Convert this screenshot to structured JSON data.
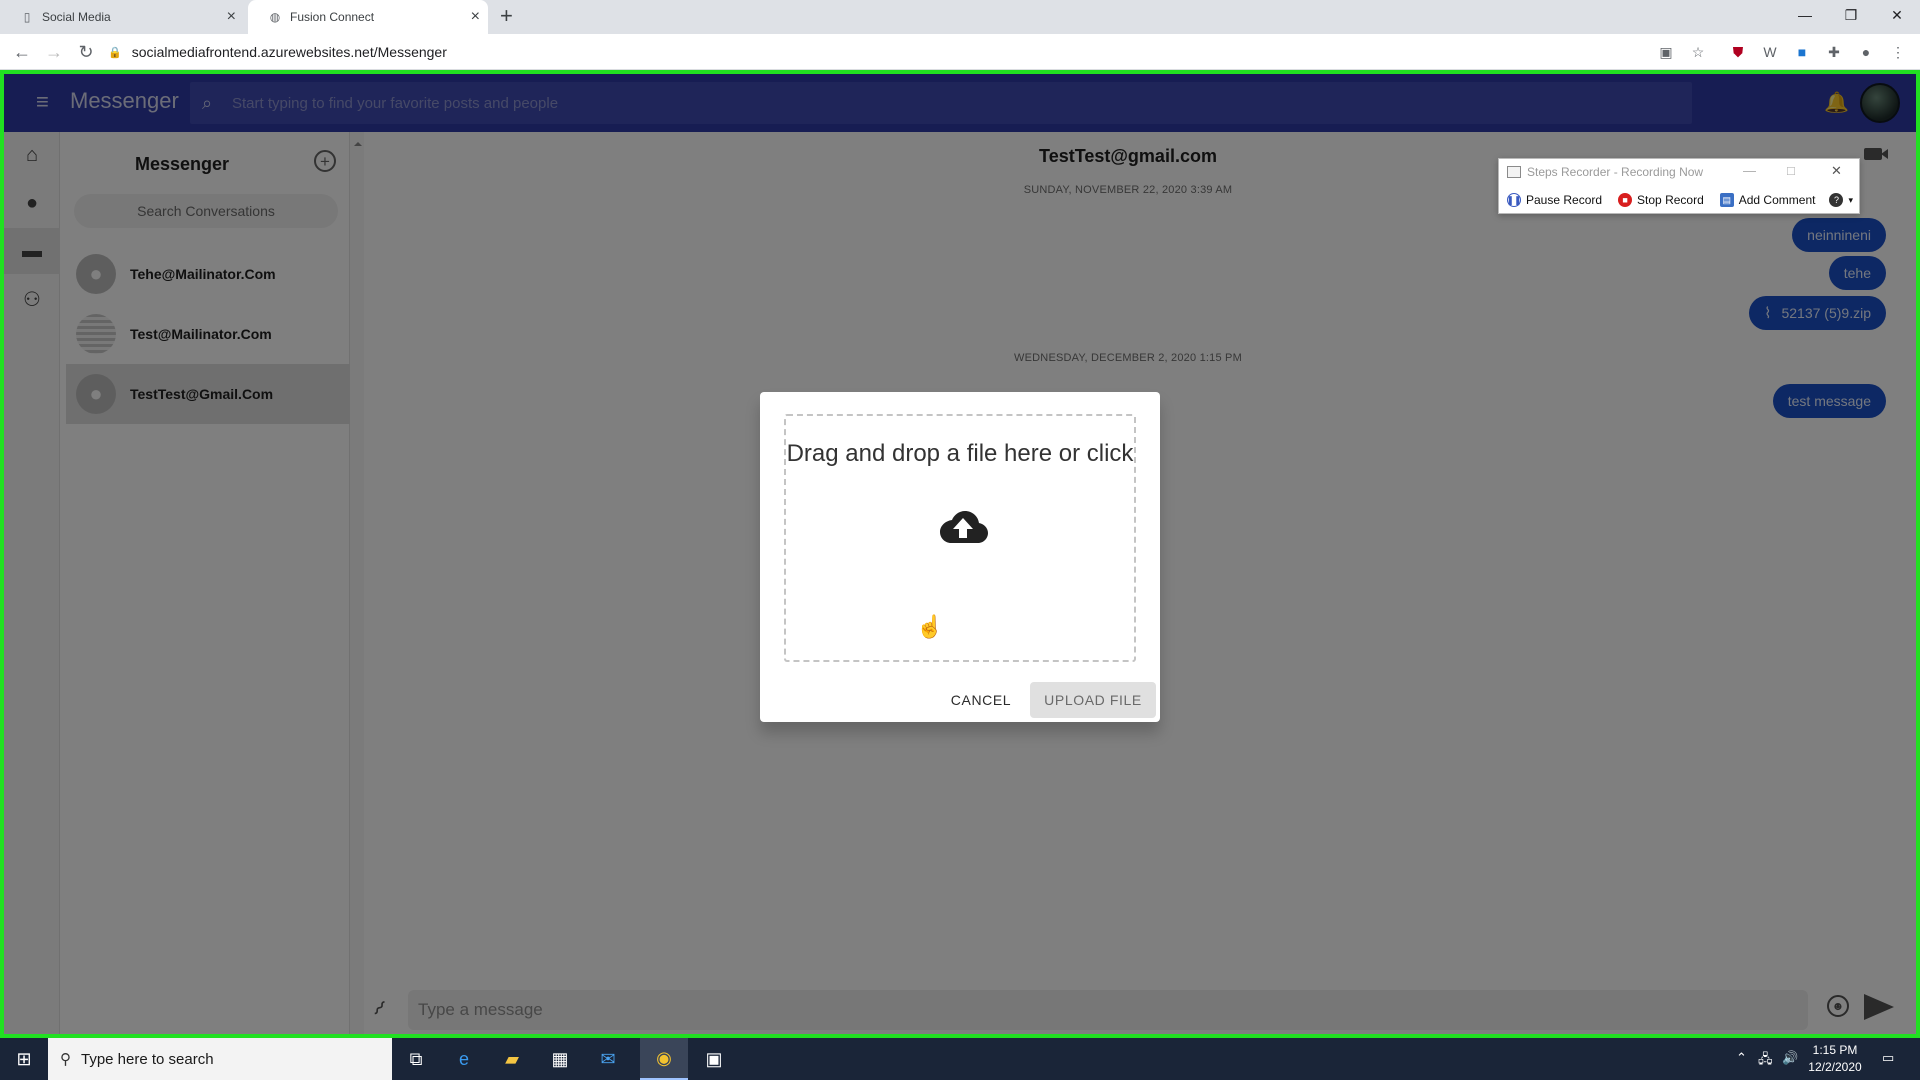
{
  "browser": {
    "tabs": [
      {
        "title": "Social Media",
        "icon": "document-icon"
      },
      {
        "title": "Fusion Connect",
        "icon": "globe-icon"
      }
    ],
    "url": "socialmediafrontend.azurewebsites.net/Messenger"
  },
  "appbar": {
    "title": "Messenger",
    "search_placeholder": "Start typing to find your favorite posts and people"
  },
  "leftnav": [
    {
      "icon": "home-icon",
      "symbol": "⌂"
    },
    {
      "icon": "profile-icon",
      "symbol": "●"
    },
    {
      "icon": "chat-icon",
      "symbol": "▬"
    },
    {
      "icon": "people-icon",
      "symbol": "⚇"
    }
  ],
  "conversations": {
    "title": "Messenger",
    "search_placeholder": "Search Conversations",
    "items": [
      {
        "name": "Tehe@Mailinator.Com"
      },
      {
        "name": "Test@Mailinator.Com"
      },
      {
        "name": "TestTest@Gmail.Com"
      }
    ]
  },
  "chat": {
    "header": "TestTest@gmail.com",
    "date1": "SUNDAY, NOVEMBER 22, 2020 3:39 AM",
    "date2": "WEDNESDAY, DECEMBER 2, 2020 1:15 PM",
    "messages": [
      {
        "text": "neinnineni"
      },
      {
        "text": "tehe"
      },
      {
        "text": "52137 (5)9.zip",
        "attachment": true
      },
      {
        "text": "test message"
      }
    ],
    "input_placeholder": "Type a message"
  },
  "dialog": {
    "dropzone_text": "Drag and drop a file here or click",
    "cancel_label": "CANCEL",
    "upload_label": "UPLOAD FILE"
  },
  "steps_recorder": {
    "title": "Steps Recorder - Recording Now",
    "pause_label": "Pause Record",
    "stop_label": "Stop Record",
    "comment_label": "Add Comment"
  },
  "taskbar": {
    "search_placeholder": "Type here to search",
    "time": "1:15 PM",
    "date": "12/2/2020"
  },
  "colors": {
    "appbar": "#2e3aa6",
    "bubble": "#1a50c8",
    "recorder_frame": "#21e021"
  }
}
